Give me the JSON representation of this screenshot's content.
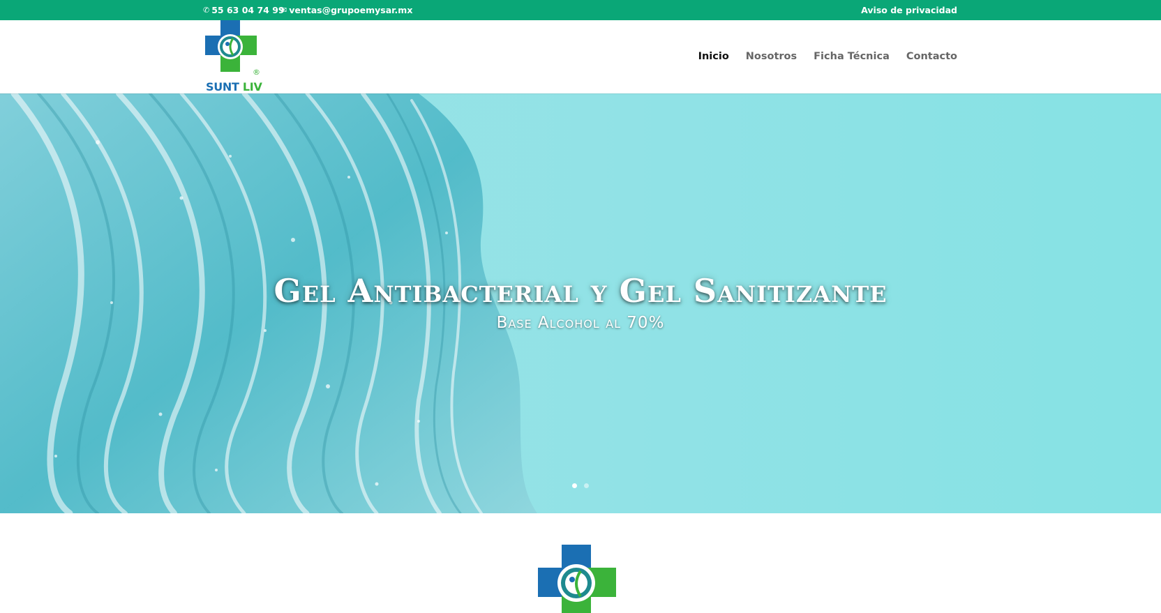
{
  "topbar": {
    "phone": "55 63 04 74 99",
    "email": "ventas@grupoemysar.mx",
    "privacy": "Aviso de privacidad",
    "phone_icon": "phone-icon",
    "email_icon": "envelope-icon"
  },
  "brand": {
    "logo_text_a": "SUNT",
    "logo_text_b": "LIV",
    "registered": "®",
    "colors": {
      "blue": "#1b6fb3",
      "green": "#3bb33a",
      "accent": "#0aa777"
    }
  },
  "nav": {
    "items": [
      "Inicio",
      "Nosotros",
      "Ficha Técnica",
      "Contacto"
    ],
    "active": "Inicio"
  },
  "hero": {
    "title": "Gel Antibacterial y Gel Sanitizante",
    "subtitle": "Base Alcohol al 70%",
    "slides_total": 2,
    "slide_active": 1
  }
}
